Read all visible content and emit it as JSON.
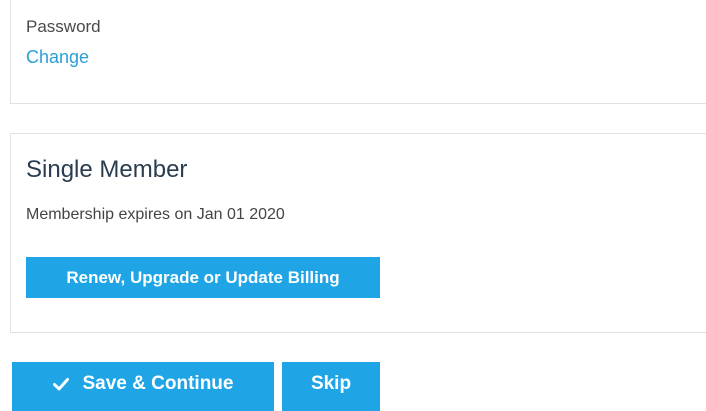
{
  "password_section": {
    "label": "Password",
    "change_link": "Change"
  },
  "membership_section": {
    "title": "Single Member",
    "expiry_text": "Membership expires on Jan 01 2020",
    "renew_button": "Renew, Upgrade or Update Billing"
  },
  "actions": {
    "save_label": "Save & Continue",
    "save_icon": "check-icon",
    "skip_label": "Skip"
  },
  "colors": {
    "accent": "#1fa5e6",
    "link": "#2a9fd8",
    "title": "#2a3d50",
    "border": "#e2e2e2"
  }
}
